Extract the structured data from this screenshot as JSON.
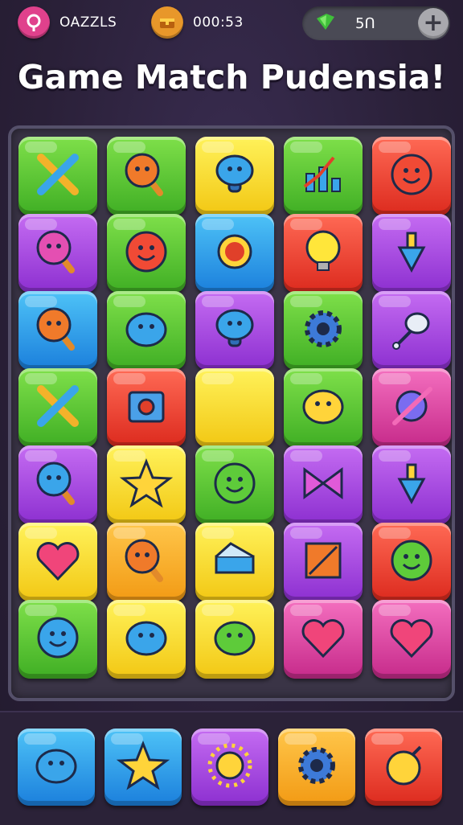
{
  "header": {
    "profile_label": "OAZZLS",
    "timer_label": "000:53",
    "currency_value": "5Ո",
    "add_button": "+"
  },
  "title": "Game Match Pudensia!",
  "board": {
    "rows": [
      [
        {
          "color": "green",
          "icon": "crossed-tools-icon"
        },
        {
          "color": "green",
          "icon": "smiley-lollipop-icon"
        },
        {
          "color": "yellow",
          "icon": "blue-mushroom-icon"
        },
        {
          "color": "green",
          "icon": "bar-chart-arrow-icon"
        },
        {
          "color": "red",
          "icon": "smiley-face-icon"
        }
      ],
      [
        {
          "color": "purple",
          "icon": "pink-lollipop-icon"
        },
        {
          "color": "green",
          "icon": "smiley-bubble-icon"
        },
        {
          "color": "blue",
          "icon": "red-gem-icon"
        },
        {
          "color": "red",
          "icon": "lightbulb-face-icon"
        },
        {
          "color": "purple",
          "icon": "spinning-top-icon"
        }
      ],
      [
        {
          "color": "blue",
          "icon": "orange-lollipop-icon"
        },
        {
          "color": "green",
          "icon": "blue-blob-icon"
        },
        {
          "color": "purple",
          "icon": "blue-mushroom-icon"
        },
        {
          "color": "green",
          "icon": "gear-icon"
        },
        {
          "color": "purple",
          "icon": "lamp-icon"
        }
      ],
      [
        {
          "color": "green",
          "icon": "crossed-swords-icon"
        },
        {
          "color": "red",
          "icon": "camera-icon"
        },
        {
          "color": "yellow",
          "icon": "empty-icon"
        },
        {
          "color": "green",
          "icon": "yellow-blob-icon"
        },
        {
          "color": "magenta",
          "icon": "planet-arrow-icon"
        }
      ],
      [
        {
          "color": "purple",
          "icon": "blue-lollipop-icon"
        },
        {
          "color": "yellow",
          "icon": "star-blob-icon"
        },
        {
          "color": "green",
          "icon": "green-smiley-icon"
        },
        {
          "color": "purple",
          "icon": "bow-icon"
        },
        {
          "color": "purple",
          "icon": "spinning-top-icon"
        }
      ],
      [
        {
          "color": "yellow",
          "icon": "heart-check-icon"
        },
        {
          "color": "orange",
          "icon": "orange-lollipop-icon"
        },
        {
          "color": "yellow",
          "icon": "piano-icon"
        },
        {
          "color": "purple",
          "icon": "square-slash-icon"
        },
        {
          "color": "red",
          "icon": "green-smiley-icon"
        }
      ],
      [
        {
          "color": "green",
          "icon": "blue-smiley-icon"
        },
        {
          "color": "yellow",
          "icon": "blue-bubble-icon"
        },
        {
          "color": "yellow",
          "icon": "green-blob-icon"
        },
        {
          "color": "magenta",
          "icon": "heart-icon"
        },
        {
          "color": "magenta",
          "icon": "heart-wand-icon"
        }
      ]
    ]
  },
  "powerups": [
    {
      "color": "blue",
      "icon": "speech-bubble-icon"
    },
    {
      "color": "blue",
      "icon": "star-icon"
    },
    {
      "color": "purple",
      "icon": "sun-face-icon"
    },
    {
      "color": "orange",
      "icon": "gear-icon"
    },
    {
      "color": "red",
      "icon": "bomb-icon"
    }
  ],
  "colors": {
    "green": "#56c232",
    "yellow": "#f7d82a",
    "red": "#ec3f30",
    "purple": "#a948e0",
    "blue": "#2e9fea",
    "magenta": "#de45a4",
    "orange": "#f5b12a"
  }
}
